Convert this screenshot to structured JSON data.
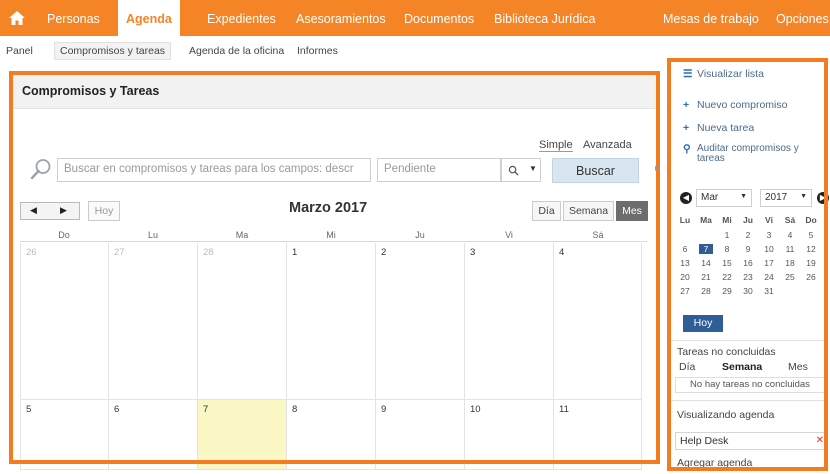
{
  "topnav": {
    "tabs": [
      "Personas",
      "Agenda",
      "Expedientes",
      "Asesoramientos",
      "Documentos",
      "Biblioteca Jurídica",
      "Mesas de trabajo",
      "Opciones"
    ],
    "active_tab": "Agenda",
    "accent_color": "#f58426"
  },
  "subnav": {
    "items": [
      "Panel",
      "Compromisos y tareas",
      "Agenda de la oficina",
      "Informes"
    ],
    "active": "Compromisos y tareas"
  },
  "main": {
    "title": "Compromisos y Tareas",
    "search_modes": [
      "Simple",
      "Avanzada"
    ],
    "active_mode": "Simple",
    "search_placeholder": "Buscar en compromisos y tareas para los campos: descr",
    "status_value": "Pendiente",
    "search_button": "Buscar",
    "calendar": {
      "today_button": "Hoy",
      "month_title": "Marzo 2017",
      "views": [
        "Día",
        "Semana",
        "Mes"
      ],
      "active_view": "Mes",
      "weekdays": [
        "Do",
        "Lu",
        "Ma",
        "Mi",
        "Ju",
        "Vi",
        "Sá"
      ],
      "rows": [
        [
          {
            "d": "26",
            "dim": true
          },
          {
            "d": "27",
            "dim": true
          },
          {
            "d": "28",
            "dim": true
          },
          {
            "d": "1"
          },
          {
            "d": "2"
          },
          {
            "d": "3"
          },
          {
            "d": "4"
          }
        ],
        [
          {
            "d": "5"
          },
          {
            "d": "6"
          },
          {
            "d": "7",
            "today": true
          },
          {
            "d": "8"
          },
          {
            "d": "9"
          },
          {
            "d": "10"
          },
          {
            "d": "11"
          }
        ]
      ]
    }
  },
  "sidebar": {
    "view_list": "Visualizar lista",
    "new_commitment": "Nuevo compromiso",
    "new_task": "Nueva tarea",
    "audit_line1": "Auditar compromisos y",
    "audit_line2": "tareas",
    "mini_cal": {
      "month": "Mar",
      "year": "2017",
      "dow": [
        "Lu",
        "Ma",
        "Mi",
        "Ju",
        "Vi",
        "Sá",
        "Do"
      ],
      "weeks": [
        [
          "",
          "",
          "1",
          "2",
          "3",
          "4",
          "5"
        ],
        [
          "6",
          "7",
          "8",
          "9",
          "10",
          "11",
          "12"
        ],
        [
          "13",
          "14",
          "15",
          "16",
          "17",
          "18",
          "19"
        ],
        [
          "20",
          "21",
          "22",
          "23",
          "24",
          "25",
          "26"
        ],
        [
          "27",
          "28",
          "29",
          "30",
          "31",
          "",
          ""
        ]
      ],
      "selected": "7",
      "today_button": "Hoy"
    },
    "unfinished_title": "Tareas no concluidas",
    "unfinished_tabs": [
      "Día",
      "Semana",
      "Mes"
    ],
    "unfinished_active": "Semana",
    "no_tasks": "No hay tareas no concluidas",
    "viewing_agenda": "Visualizando agenda",
    "agenda_item": "Help Desk",
    "add_agenda": "Agregar agenda"
  }
}
